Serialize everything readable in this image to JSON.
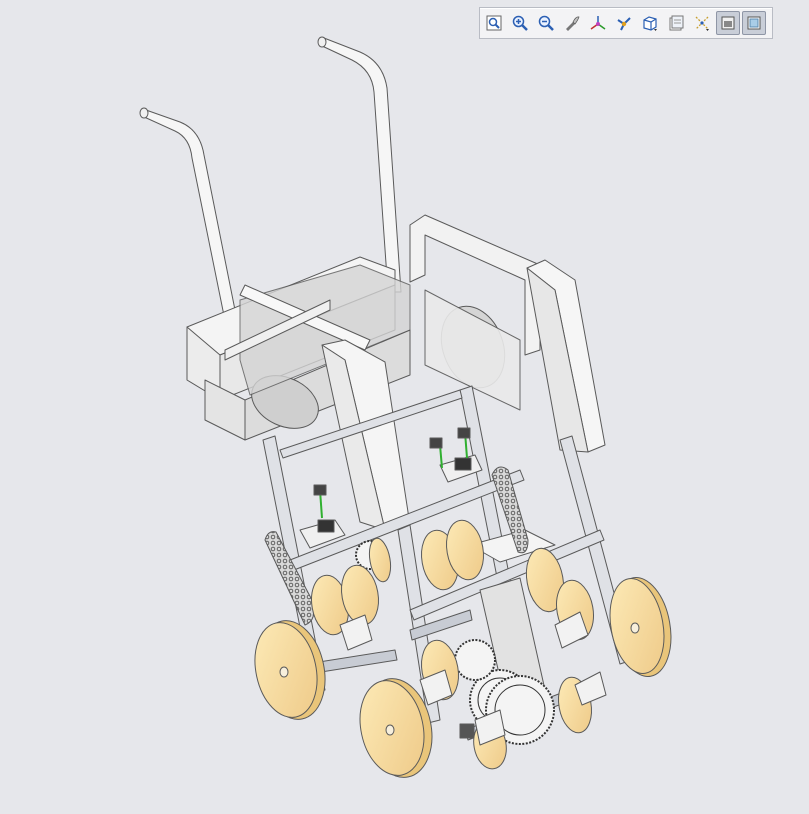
{
  "viewport": {
    "background": "#e6e7eb",
    "model_name": "stair-climbing-wheelchair"
  },
  "toolbar": {
    "buttons": [
      {
        "icon": "zoom-fit-icon",
        "active": false
      },
      {
        "icon": "zoom-in-icon",
        "active": false
      },
      {
        "icon": "zoom-out-icon",
        "active": false
      },
      {
        "icon": "repaint-icon",
        "active": false
      },
      {
        "icon": "orient-icon",
        "active": false
      },
      {
        "icon": "spin-center-icon",
        "active": false
      },
      {
        "icon": "saved-views-icon",
        "active": false
      },
      {
        "icon": "layers-icon",
        "active": false
      },
      {
        "icon": "datum-display-icon",
        "active": false
      },
      {
        "icon": "display-style-icon",
        "active": true
      },
      {
        "icon": "shading-icon",
        "active": true
      }
    ]
  },
  "colors": {
    "frame": "#f4f4f4",
    "frame_stroke": "#5a5a5a",
    "wheel": "#fae0a0",
    "wheel_dark": "#e9c57a",
    "chain": "#8a8a8a",
    "axle": "#c8ccd4",
    "accent": "#30b030"
  }
}
